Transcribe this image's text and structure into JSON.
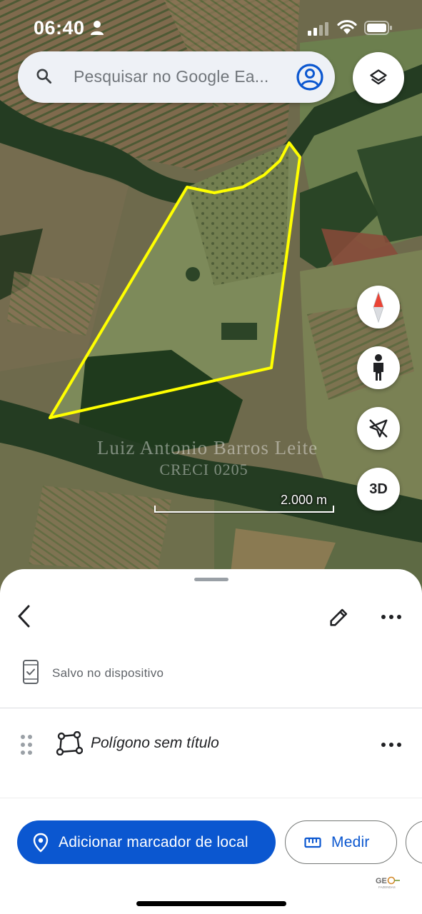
{
  "status_bar": {
    "time": "06:40",
    "icons": [
      "person-icon",
      "cellular-signal-icon",
      "wifi-icon",
      "battery-icon"
    ]
  },
  "search": {
    "placeholder": "Pesquisar no Google Ea...",
    "icons": [
      "search-icon",
      "account-icon"
    ]
  },
  "map": {
    "watermark_line1": "Luiz Antonio Barros Leite",
    "watermark_line2": "CRECI 0205",
    "scale_label": "2.000 m",
    "polygon_color": "#ffff00",
    "controls": {
      "layers_icon": "layers-icon",
      "compass_icon": "compass-icon",
      "pegman_icon": "pegman-icon",
      "location_icon": "location-off-icon",
      "three_d_label": "3D"
    }
  },
  "sheet": {
    "saved_label": "Salvo no dispositivo",
    "item_title": "Polígono sem título",
    "add_marker_label": "Adicionar marcador de local",
    "measure_label": "Medir",
    "brand_text": "GEO FAZENDAS"
  },
  "colors": {
    "accent": "#0b57d0",
    "polygon": "#ffff00",
    "compass_red": "#ea4335"
  }
}
